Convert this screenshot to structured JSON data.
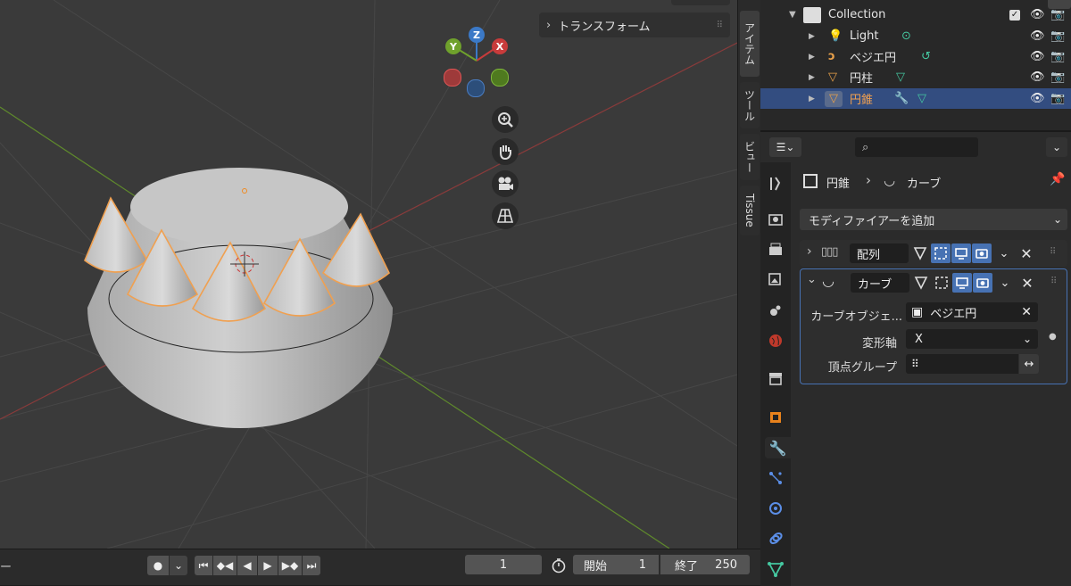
{
  "viewport": {
    "npanel_header": "トランスフォーム",
    "gizmo": {
      "x": "X",
      "y": "Y",
      "z": "Z"
    },
    "side_tabs": [
      "アイテム",
      "ツール",
      "ビュー",
      "Tissue"
    ]
  },
  "timeline": {
    "current_frame": "1",
    "start_label": "開始",
    "start_value": "1",
    "end_label": "終了",
    "end_value": "250",
    "left_label": "ー"
  },
  "outliner": {
    "collection": "Collection",
    "items": [
      {
        "name": "Light",
        "color": "#e6e6e6"
      },
      {
        "name": "ベジエ円",
        "color": "#e6e6e6"
      },
      {
        "name": "円柱",
        "color": "#e6e6e6"
      },
      {
        "name": "円錐",
        "color": "#f0a050"
      }
    ]
  },
  "properties": {
    "breadcrumb_object": "円錐",
    "breadcrumb_modifier": "カーブ",
    "add_modifier": "モディファイアーを追加",
    "modifiers": [
      {
        "name": "配列",
        "expanded": false
      },
      {
        "name": "カーブ",
        "expanded": true
      }
    ],
    "curve_object_label": "カーブオブジェ...",
    "curve_object_value": "ベジエ円",
    "deform_axis_label": "変形軸",
    "deform_axis_value": "X",
    "vertex_group_label": "頂点グループ"
  },
  "colors": {
    "accent": "#4772b3",
    "selected": "#f0a050",
    "panel_bg": "#2b2b2b",
    "viewport_bg": "#3a3a3a"
  }
}
